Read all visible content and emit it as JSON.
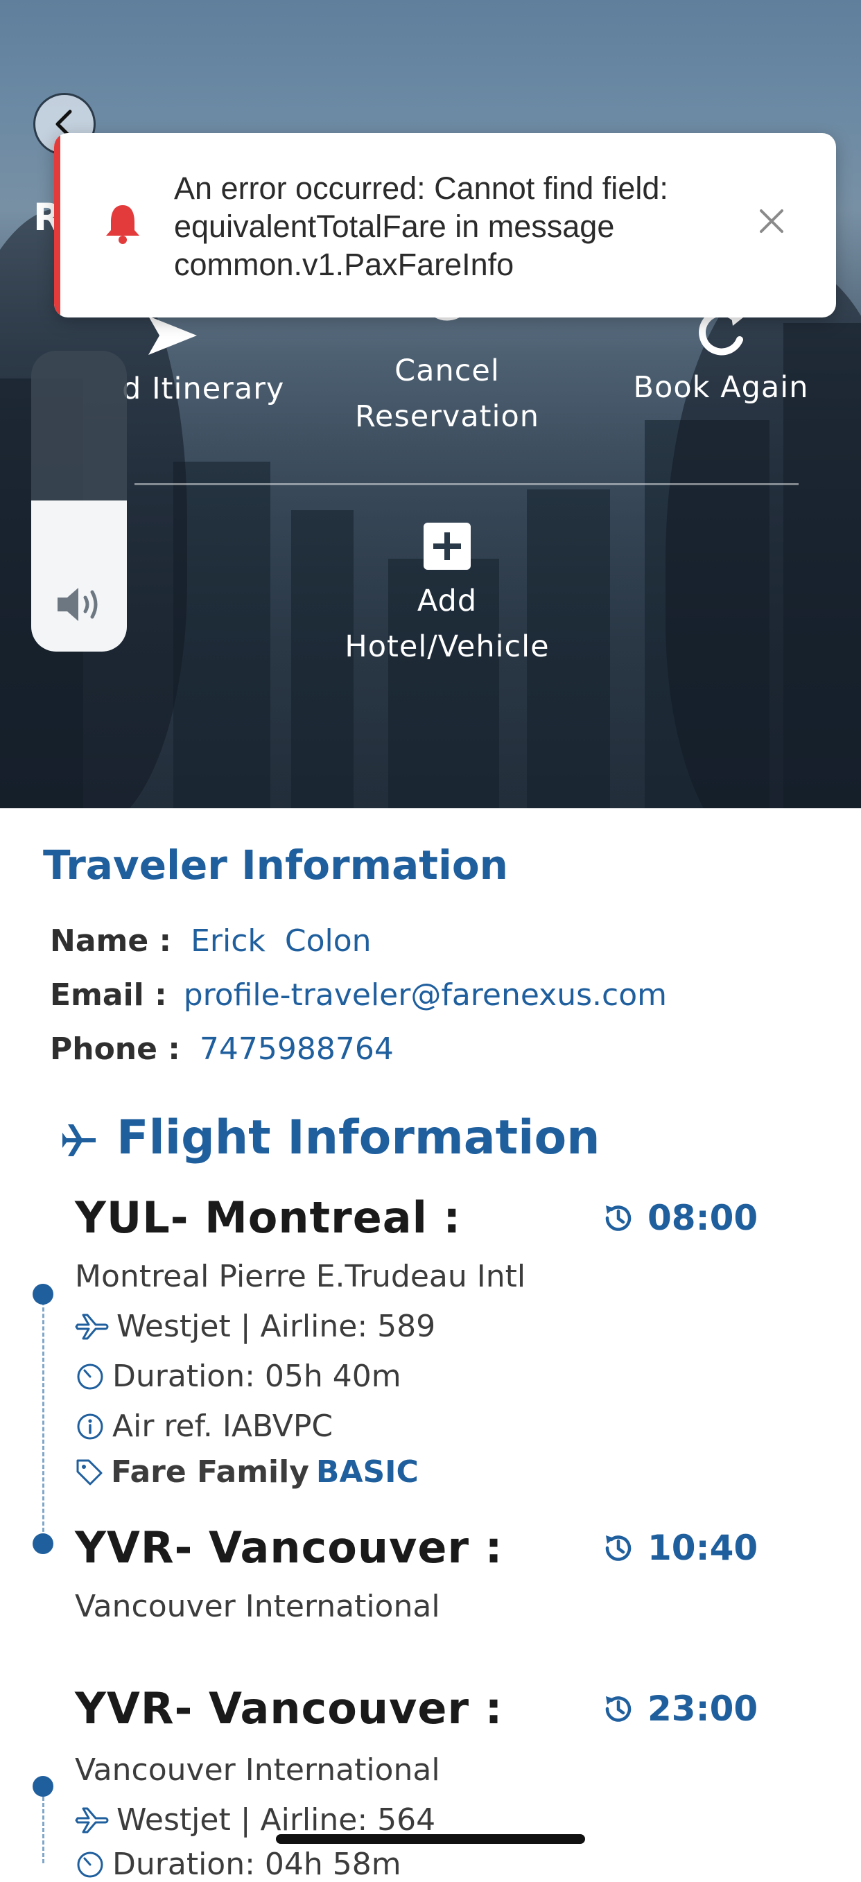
{
  "hero": {
    "title_initial": "R",
    "actions": [
      {
        "label": "d Itinerary",
        "icon": "send-icon"
      },
      {
        "label": "Cancel Reservation",
        "icon": "cancel-icon"
      },
      {
        "label": "Book Again",
        "icon": "refresh-icon"
      }
    ],
    "add_action": {
      "label": "Add Hotel/Vehicle",
      "icon": "plus-icon"
    }
  },
  "volume_hud": {
    "level_fraction": 0.5,
    "icon": "speaker-icon"
  },
  "toast": {
    "message": "An error occurred: Cannot find field: equivalentTotalFare in message common.v1.PaxFareInfo",
    "icon": "bell-icon",
    "accent_color": "#e33b3b"
  },
  "traveler": {
    "title": "Traveler Information",
    "name_label": "Name :",
    "name_value": "Erick  Colon",
    "email_label": "Email :",
    "email_value": "profile-traveler@farenexus.com",
    "phone_label": "Phone :",
    "phone_value": "7475988764"
  },
  "flight": {
    "title": "Flight Information",
    "segments": [
      {
        "title": "YUL- Montreal :",
        "time": "08:00",
        "airport": "Montreal Pierre E.Trudeau Intl",
        "airline": "Westjet | Airline: 589",
        "duration": "Duration: 05h 40m",
        "air_ref": "Air ref. IABVPC",
        "fare_family_label": "Fare Family",
        "fare_family_value": "BASIC"
      },
      {
        "title": "YVR- Vancouver :",
        "time": "10:40",
        "airport": "Vancouver International"
      },
      {
        "title": "YVR- Vancouver :",
        "time": "23:00",
        "airport": "Vancouver International",
        "airline": "Westjet | Airline: 564",
        "duration": "Duration: 04h 58m"
      }
    ]
  },
  "colors": {
    "brand_blue": "#1f5f9e",
    "error_red": "#e33b3b"
  }
}
